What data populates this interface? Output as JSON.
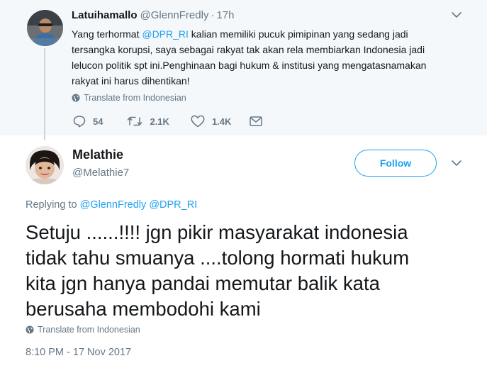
{
  "parent_tweet": {
    "author_name": "Latuihamallo",
    "author_handle": "@GlennFredly",
    "separator": "·",
    "time": "17h",
    "text_lines": [
      [
        "Yang terhormat ",
        "@DPR_RI",
        " kalian memiliki pucuk pimipinan yang sedang jadi"
      ],
      "tersangka korupsi, saya sebagai rakyat tak akan rela membiarkan Indonesia jadi",
      "lelucon politik spt ini.Penghinaan bagi hukum & institusi yang mengatasnamakan",
      "rakyat ini harus dihentikan!"
    ],
    "translate_label": "Translate from Indonesian",
    "replies_count": "54",
    "retweets_count": "2.1K",
    "likes_count": "1.4K"
  },
  "reply_tweet": {
    "author_name": "Melathie",
    "author_handle": "@Melathie7",
    "follow_label": "Follow",
    "replying_prefix": "Replying to ",
    "replying_to": [
      "@GlennFredly",
      "@DPR_RI"
    ],
    "text_lines": [
      "Setuju ......!!!! jgn pikir masyarakat indonesia",
      "tidak tahu smuanya ....tolong hormati hukum",
      "kita jgn hanya pandai memutar balik kata",
      "berusaha membodohi kami"
    ],
    "translate_label": "Translate from Indonesian",
    "timestamp": "8:10 PM - 17 Nov 2017"
  },
  "icons": {
    "reply": "reply-icon",
    "retweet": "retweet-icon",
    "like": "heart-icon",
    "message": "envelope-icon",
    "globe": "globe-icon",
    "caret": "chevron-down-icon"
  },
  "colors": {
    "accent": "#1da1f2",
    "muted": "#657786",
    "text": "#14171a",
    "parent_background": "#f5f8fa"
  }
}
